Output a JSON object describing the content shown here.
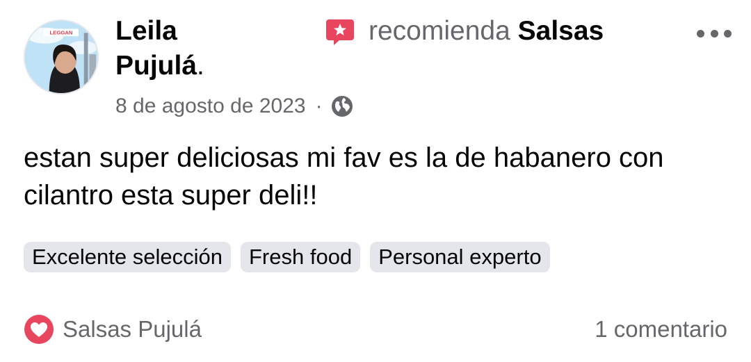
{
  "post": {
    "author": {
      "first_name": "Leila",
      "last_name": "Pujulá",
      "trailing": ".",
      "avatar_badge_text": "LEGGAN"
    },
    "recommends_text": "recomienda",
    "page_name": "Salsas",
    "date": "8 de agosto de 2023",
    "separator": "·",
    "privacy_icon": "globe-icon",
    "body": "estan super deliciosas mi fav es la de habanero con cilantro esta super deli!!",
    "tags": [
      "Excelente selección",
      "Fresh food",
      "Personal experto"
    ],
    "reaction": {
      "icon": "heart-icon",
      "label": "Salsas Pujulá"
    },
    "comments_label": "1 comentario"
  },
  "colors": {
    "recommend_icon": "#e8455e",
    "heart": "#e8455e",
    "muted_text": "#65676b",
    "tag_bg": "#e4e6eb"
  }
}
